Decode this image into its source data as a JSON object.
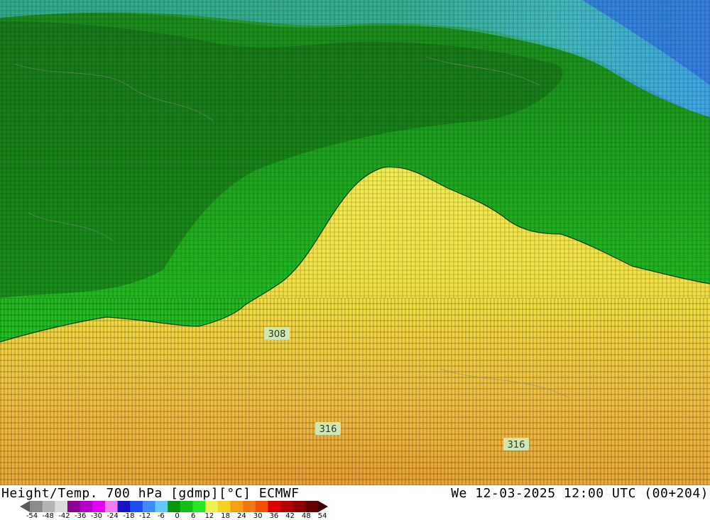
{
  "map": {
    "contour_labels": [
      "308",
      "316",
      "316"
    ]
  },
  "footer": {
    "title": "Height/Temp. 700 hPa [gdmp][°C] ECMWF",
    "datetime": "We 12-03-2025 12:00 UTC (00+204)"
  },
  "legend": {
    "ticks": [
      "-54",
      "-48",
      "-42",
      "-36",
      "-30",
      "-24",
      "-18",
      "-12",
      "-6",
      "0",
      "6",
      "12",
      "18",
      "24",
      "30",
      "36",
      "42",
      "48",
      "54"
    ],
    "colors": [
      "#5a5a5a",
      "#8c8c8c",
      "#b4b4b4",
      "#dcdcdc",
      "#8c0096",
      "#b400c8",
      "#e600f0",
      "#f07cf0",
      "#1414c8",
      "#1e50f0",
      "#3c8cff",
      "#64c8ff",
      "#0a960a",
      "#14be14",
      "#28e628",
      "#f0f050",
      "#f5d21e",
      "#f5a014",
      "#f07814",
      "#f05000",
      "#dc0000",
      "#b40000",
      "#8c0000",
      "#640000",
      "#3c0000"
    ]
  }
}
